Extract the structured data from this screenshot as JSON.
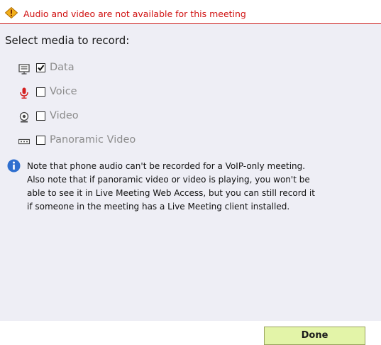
{
  "warning": {
    "icon": "warning-diamond-icon",
    "text": "Audio and video are not available for this meeting",
    "color": "#d01010"
  },
  "media_heading": "Select media to record:",
  "media_options": [
    {
      "icon": "data-icon",
      "label": "Data",
      "checked": true
    },
    {
      "icon": "microphone-icon",
      "label": "Voice",
      "checked": false
    },
    {
      "icon": "webcam-icon",
      "label": "Video",
      "checked": false
    },
    {
      "icon": "panoramic-camera-icon",
      "label": "Panoramic Video",
      "checked": false
    }
  ],
  "note": {
    "icon": "info-icon",
    "lines": [
      "Note that phone audio can't be recorded for a VoIP-only meeting.",
      "Also note that if panoramic video or video is playing, you won't be",
      "able to see it in Live Meeting Web Access, but you can still record it",
      "if someone in the meeting has a Live Meeting client installed."
    ]
  },
  "done_label": "Done",
  "colors": {
    "panel_bg": "#eeeef5",
    "warning_line": "#c91818",
    "button_bg": "#e3f4a8",
    "disabled_text": "#8c8c8c"
  }
}
